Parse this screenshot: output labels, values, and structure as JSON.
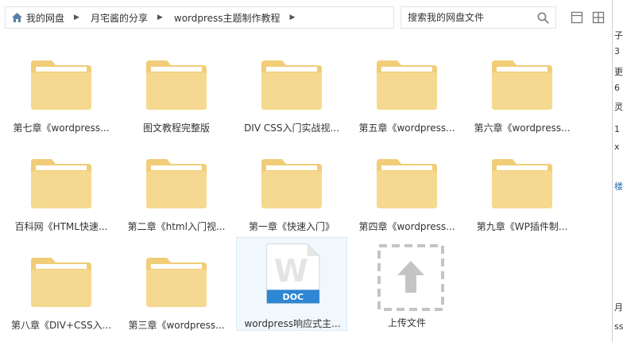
{
  "breadcrumb": [
    {
      "label": "我的网盘"
    },
    {
      "label": "月宅酱的分享"
    },
    {
      "label": "wordpress主题制作教程"
    }
  ],
  "search": {
    "placeholder": "搜索我的网盘文件",
    "icon": "search-icon"
  },
  "view_buttons": [
    {
      "icon": "list-view-icon"
    },
    {
      "icon": "grid-view-icon"
    }
  ],
  "files": [
    {
      "name": "第七章《wordpress...",
      "type": "folder"
    },
    {
      "name": "图文教程完整版",
      "type": "folder"
    },
    {
      "name": "DIV CSS入门实战视...",
      "type": "folder"
    },
    {
      "name": "第五章《wordpress...",
      "type": "folder"
    },
    {
      "name": "第六章《wordpress...",
      "type": "folder"
    },
    {
      "name": "百科网《HTML快速...",
      "type": "folder"
    },
    {
      "name": "第二章《html入门视...",
      "type": "folder"
    },
    {
      "name": "第一章《快速入门》",
      "type": "folder"
    },
    {
      "name": "第四章《wordpress...",
      "type": "folder"
    },
    {
      "name": "第九章《WP插件制...",
      "type": "folder"
    },
    {
      "name": "第八章《DIV+CSS入...",
      "type": "folder"
    },
    {
      "name": "第三章《wordpress...",
      "type": "folder"
    },
    {
      "name": "wordpress响应式主...",
      "type": "doc",
      "badge": "DOC"
    },
    {
      "name": "上传文件",
      "type": "upload"
    }
  ],
  "colors": {
    "folder_body": "#f6d990",
    "folder_back": "#f1cd78",
    "doc_badge": "#2f86d2",
    "selected_bg": "#f1f8fd"
  },
  "right_strip_chars": [
    "子",
    "3",
    "更",
    "6",
    "灵",
    "1",
    "x",
    "楼",
    "月",
    "ss"
  ]
}
